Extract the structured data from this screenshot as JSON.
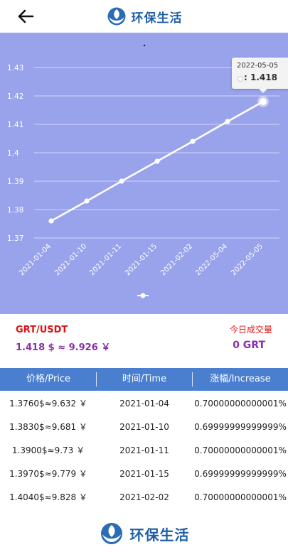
{
  "header": {
    "back_icon": "arrow-left-icon",
    "brand_name": "环保生活",
    "brand_icon": "leaf-hands-logo-icon",
    "brand_color": "#1f5fa8"
  },
  "chart_data": {
    "type": "line",
    "x": [
      "2021-01-04",
      "2021-01-10",
      "2021-01-11",
      "2021-01-15",
      "2021-02-02",
      "2022-05-04",
      "2022-05-05"
    ],
    "values": [
      1.376,
      1.383,
      1.39,
      1.397,
      1.404,
      1.411,
      1.418
    ],
    "ylim": [
      1.37,
      1.43
    ],
    "yticks": [
      "1.37",
      "1.38",
      "1.39",
      "1.4",
      "1.41",
      "1.42",
      "1.43"
    ],
    "grid": true,
    "background": "#99a3ec",
    "line_color": "#ffffff",
    "tooltip": {
      "date": "2022-05-05",
      "value": ": 1.418"
    }
  },
  "pair": {
    "name": "GRT/USDT",
    "price": "1.418 $ ≈ 9.926 ￥",
    "volume_label": "今日成交量",
    "volume_value": "0 GRT"
  },
  "table": {
    "header_color": "#4a7fd0",
    "headers": [
      "价格/Price",
      "时间/Time",
      "涨幅/Increase"
    ],
    "rows": [
      {
        "price": "1.3760$≈9.632 ￥",
        "time": "2021-01-04",
        "increase": "0.70000000000001%"
      },
      {
        "price": "1.3830$≈9.681 ￥",
        "time": "2021-01-10",
        "increase": "0.69999999999999%"
      },
      {
        "price": "1.3900$≈9.73 ￥",
        "time": "2021-01-11",
        "increase": "0.70000000000001%"
      },
      {
        "price": "1.3970$≈9.779 ￥",
        "time": "2021-01-15",
        "increase": "0.69999999999999%"
      },
      {
        "price": "1.4040$≈9.828 ￥",
        "time": "2021-02-02",
        "increase": "0.70000000000001%"
      }
    ]
  },
  "footer": {
    "brand_name": "环保生活",
    "brand_icon": "leaf-hands-logo-icon"
  }
}
